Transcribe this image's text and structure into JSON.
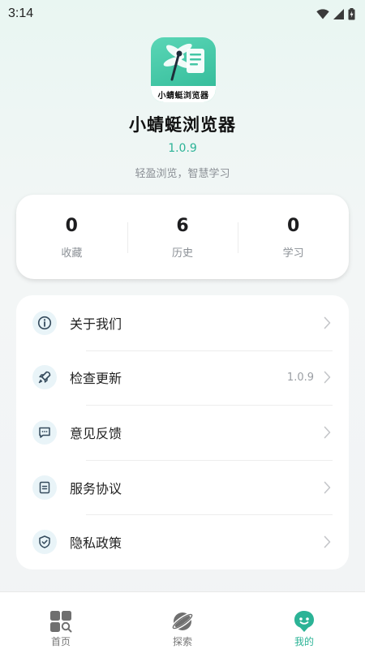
{
  "status_bar": {
    "time": "3:14",
    "icons": [
      "wifi-icon",
      "cellular-signal-icon",
      "battery-icon"
    ]
  },
  "header": {
    "logo_text": "小蜻蜓浏览器",
    "app_name": "小蜻蜓浏览器",
    "version": "1.0.9",
    "slogan": "轻盈浏览，智慧学习"
  },
  "stats": [
    {
      "value": "0",
      "label": "收藏"
    },
    {
      "value": "6",
      "label": "历史"
    },
    {
      "value": "0",
      "label": "学习"
    }
  ],
  "menu": [
    {
      "label": "关于我们",
      "icon": "info-icon",
      "extra": ""
    },
    {
      "label": "检查更新",
      "icon": "rocket-icon",
      "extra": "1.0.9"
    },
    {
      "label": "意见反馈",
      "icon": "feedback-icon",
      "extra": ""
    },
    {
      "label": "服务协议",
      "icon": "document-icon",
      "extra": ""
    },
    {
      "label": "隐私政策",
      "icon": "shield-check-icon",
      "extra": ""
    }
  ],
  "bottom_nav": [
    {
      "label": "首页",
      "icon": "home-grid-icon",
      "active": false
    },
    {
      "label": "探索",
      "icon": "planet-icon",
      "active": false
    },
    {
      "label": "我的",
      "icon": "profile-icon",
      "active": true
    }
  ],
  "colors": {
    "accent": "#2bb396",
    "icon_stroke": "#344a5c",
    "icon_bg": "#e9f4f8"
  }
}
